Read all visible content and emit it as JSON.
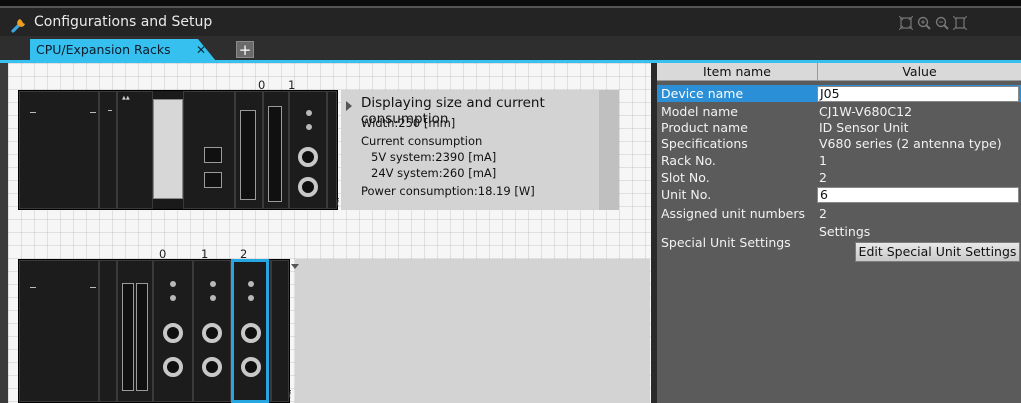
{
  "window": {
    "title": "Configurations and Setup",
    "tools": [
      "fit-icon",
      "zoom-in-icon",
      "zoom-out-icon",
      "fit-width-icon"
    ]
  },
  "tabs": [
    {
      "label": "CPU/Expansion Racks",
      "active": true
    }
  ],
  "add_tab_label": "+",
  "racks": [
    {
      "slot_numbers": [
        "0",
        "1"
      ],
      "info": {
        "title": "Displaying size and current consumption",
        "width": "Width:250 [mm]",
        "current_label": "Current consumption",
        "v5": "5V system:2390 [mA]",
        "v24": "24V system:260 [mA]",
        "power": "Power consumption:18.19 [W]"
      },
      "info_mark": "i"
    },
    {
      "slot_numbers": [
        "0",
        "1",
        "2"
      ],
      "selected_slot": "2",
      "info_mark": "i"
    }
  ],
  "properties": {
    "header": {
      "name": "Item name",
      "value": "Value"
    },
    "rows": [
      {
        "name": "Device name",
        "value": "J05",
        "editable": true,
        "active": true
      },
      {
        "name": "Model name",
        "value": "CJ1W-V680C12"
      },
      {
        "name": "Product name",
        "value": "ID Sensor Unit"
      },
      {
        "name": "Specifications",
        "value": "V680 series (2 antenna type)"
      },
      {
        "name": "Rack No.",
        "value": "1"
      },
      {
        "name": "Slot No.",
        "value": "2"
      },
      {
        "name": "Unit No.",
        "value": "6",
        "editable": true
      },
      {
        "name": "Assigned unit numbers",
        "value": "2"
      }
    ],
    "special": {
      "name": "Special Unit Settings",
      "value": "Settings",
      "button": "Edit Special Unit Settings"
    }
  },
  "colors": {
    "accent": "#35c0ef",
    "selection": "#27a7e2",
    "active_row": "#2a8fd6",
    "panel_bg": "#5b5b5b"
  }
}
